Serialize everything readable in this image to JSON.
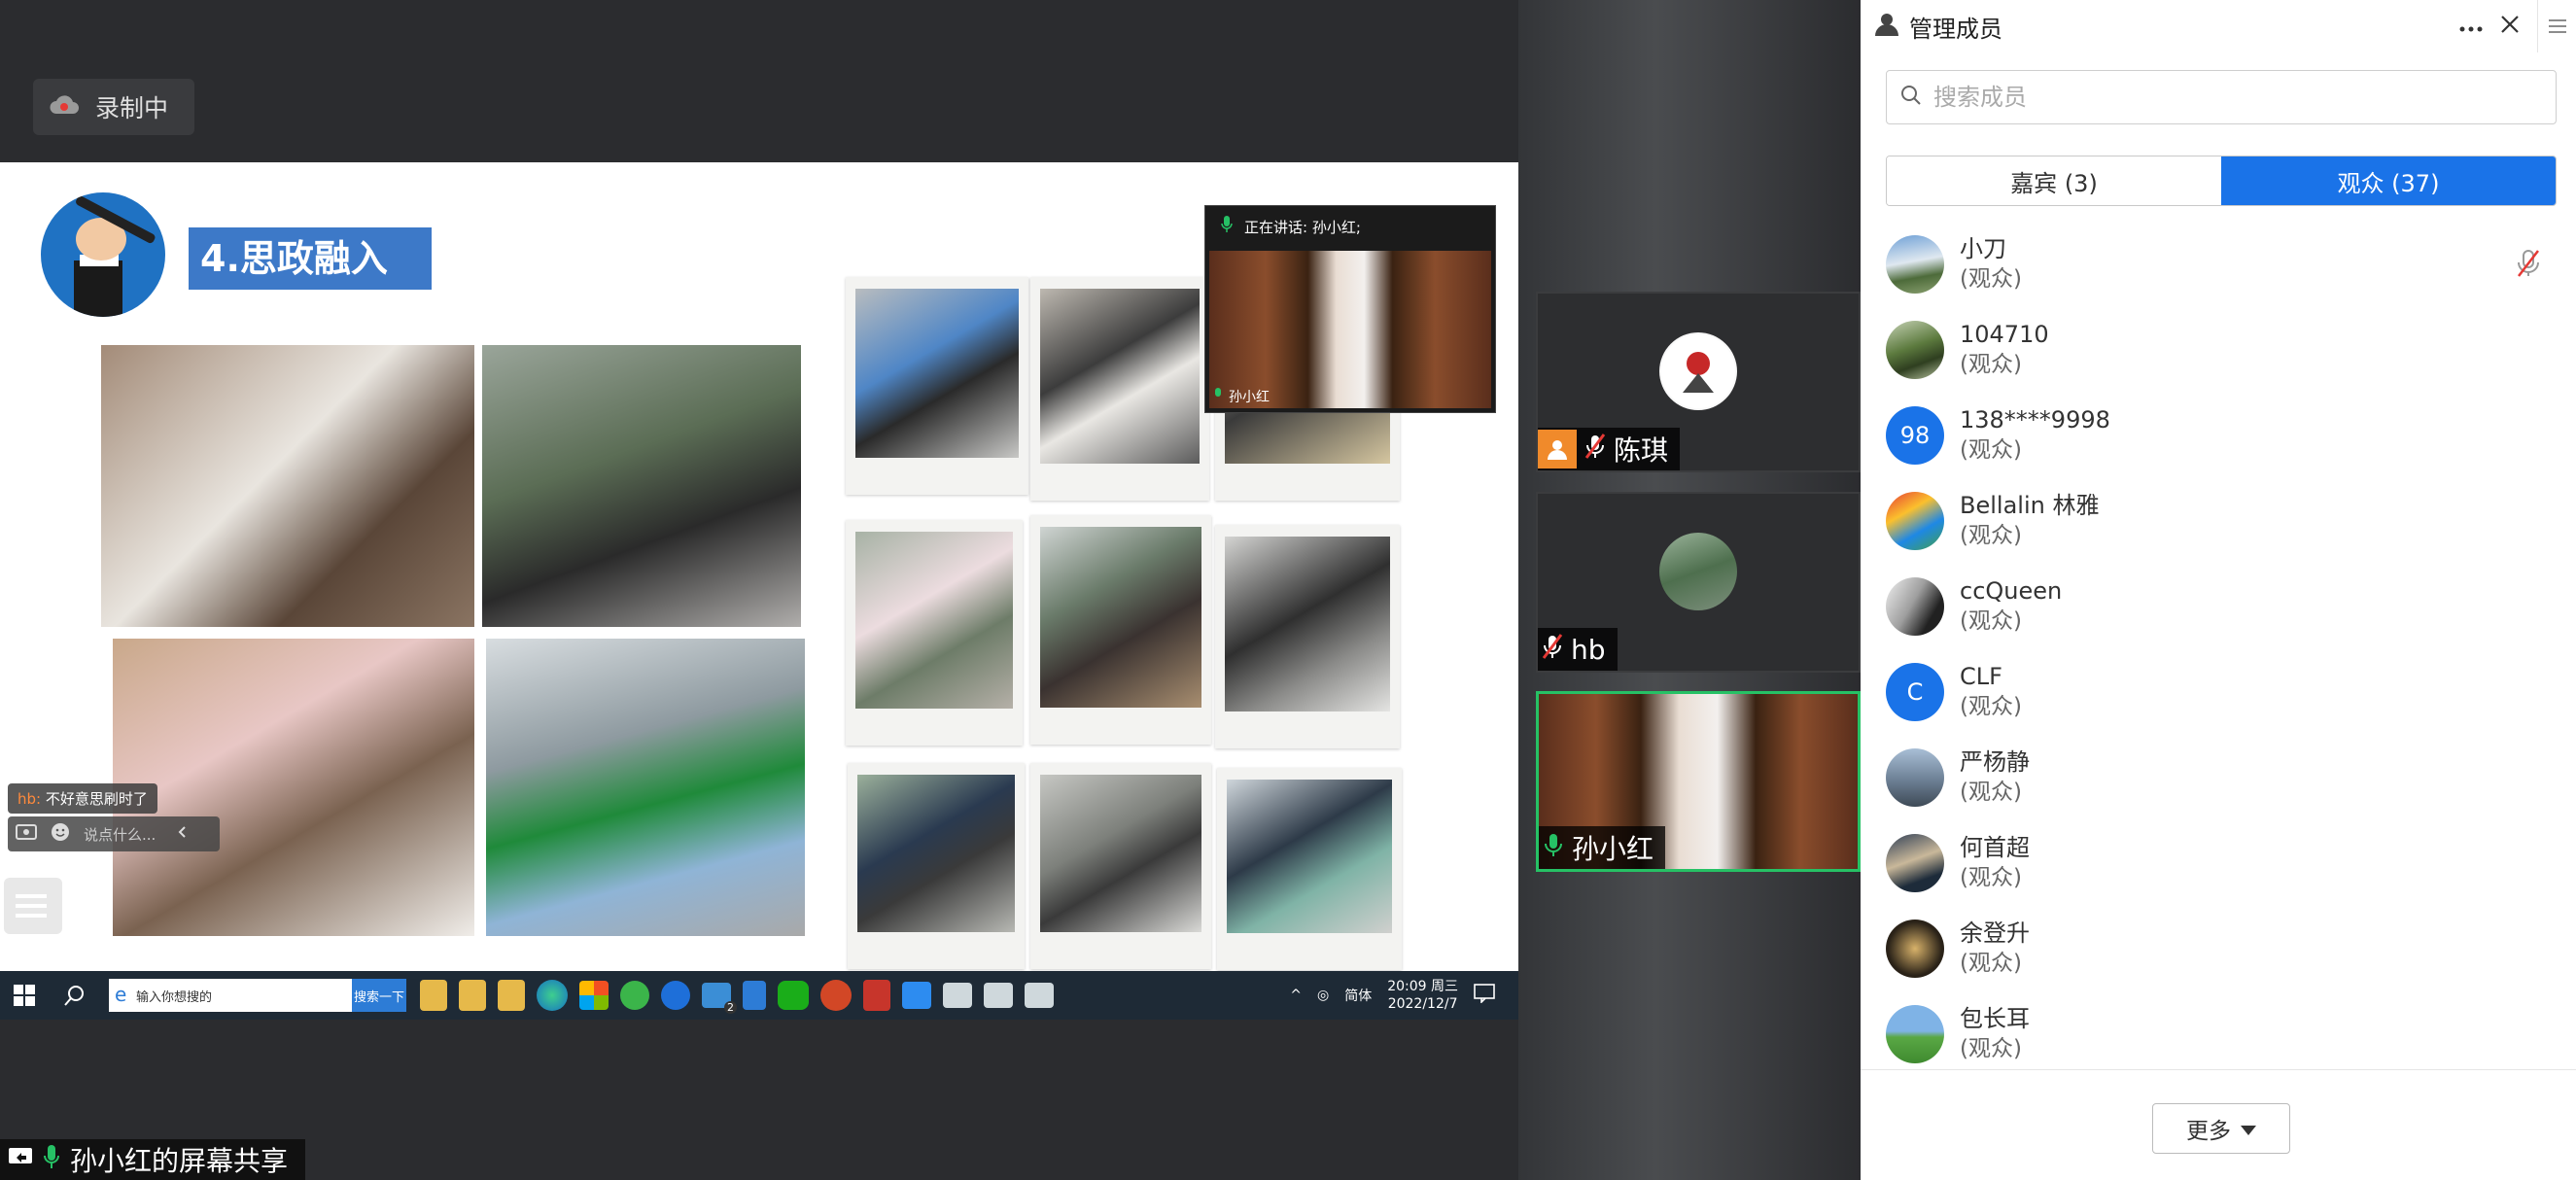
{
  "recording": {
    "label": "录制中"
  },
  "slide": {
    "title": "4.思政融入"
  },
  "floating_speaker": {
    "status": "正在讲话: 孙小红;",
    "name": "孙小红"
  },
  "chat": {
    "last_user": "hb:",
    "last_message": "不好意思刷时了",
    "input_placeholder": "说点什么..."
  },
  "taskbar": {
    "search_placeholder": "输入你想搜的",
    "search_button": "搜索一下",
    "ime": "简体",
    "time": "20:09 周三",
    "date": "2022/12/7",
    "mail_badge": "2"
  },
  "share_label": "孙小红的屏幕共享",
  "video_tiles": [
    {
      "name": "陈琪"
    },
    {
      "name": "hb"
    },
    {
      "name": "孙小红"
    }
  ],
  "panel": {
    "title": "管理成员",
    "search_placeholder": "搜索成员",
    "tabs": [
      {
        "label": "嘉宾 (3)"
      },
      {
        "label": "观众 (37)"
      }
    ],
    "members": [
      {
        "name": "小刀",
        "role": "(观众)"
      },
      {
        "name": "104710",
        "role": "(观众)"
      },
      {
        "name": "138****9998",
        "role": "(观众)",
        "initials": "98"
      },
      {
        "name": "Bellalin 林雅",
        "role": "(观众)"
      },
      {
        "name": "ccQueen",
        "role": "(观众)"
      },
      {
        "name": "CLF",
        "role": "(观众)",
        "initials": "C"
      },
      {
        "name": "严杨静",
        "role": "(观众)"
      },
      {
        "name": "何首超",
        "role": "(观众)"
      },
      {
        "name": "余登升",
        "role": "(观众)"
      },
      {
        "name": "包长耳",
        "role": "(观众)"
      }
    ],
    "more_button": "更多"
  },
  "colors": {
    "accent": "#1a73e8",
    "active_speaker": "#26c165",
    "host_badge": "#f08a2b"
  }
}
